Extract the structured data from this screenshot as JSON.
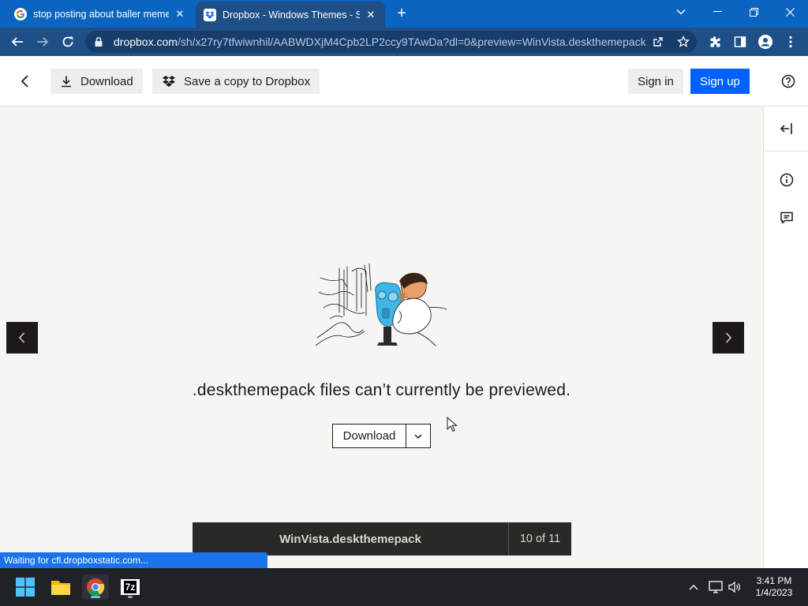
{
  "browser": {
    "tabs": [
      {
        "title": "stop posting about baller meme",
        "icon": "google-icon"
      },
      {
        "title": "Dropbox - Windows Themes - Si",
        "icon": "dropbox-icon"
      }
    ],
    "new_tab_icon": "+",
    "address": {
      "host": "dropbox.com",
      "path": "/sh/x27ry7tfwiwnhil/AABWDXjM4Cpb2LP2ccy9TAwDa?dl=0&preview=WinVista.deskthemepack"
    },
    "status_text": "Waiting for cfl.dropboxstatic.com..."
  },
  "header": {
    "download_label": "Download",
    "save_label": "Save a copy to Dropbox",
    "sign_in_label": "Sign in",
    "sign_up_label": "Sign up"
  },
  "preview": {
    "message": ".deskthemepack files can’t currently be previewed.",
    "download_label": "Download",
    "file_name": "WinVista.deskthemepack",
    "position": "10 of 11"
  },
  "taskbar": {
    "time": "3:41 PM",
    "date": "1/4/2023",
    "app_7zip_label": "7z"
  },
  "colors": {
    "chrome_tabstrip": "#0b64c0",
    "chrome_toolbar": "#1e4f86",
    "dropbox_blue": "#0061fe",
    "canvas": "#f7f5f2",
    "dark": "#1e1919"
  }
}
